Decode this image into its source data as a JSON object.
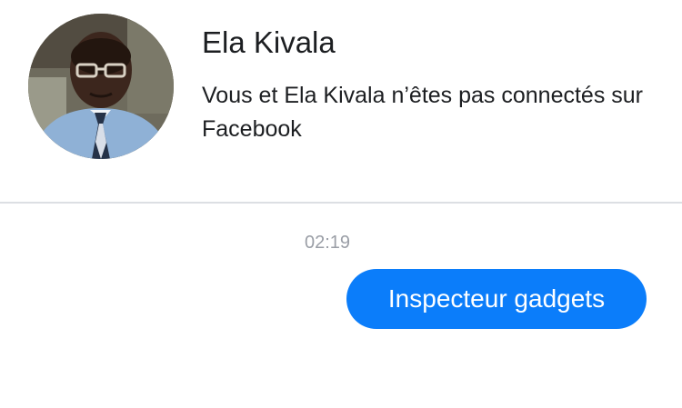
{
  "contact": {
    "name": "Ela Kivala",
    "connection_note": "Vous et Ela Kivala n’êtes pas connectés sur Facebook",
    "avatar_icon": "profile-photo"
  },
  "conversation": {
    "timestamp": "02:19",
    "messages": [
      {
        "direction": "outgoing",
        "text": "Inspecteur gadgets",
        "color": "#0B7DFA"
      }
    ]
  },
  "colors": {
    "background": "#FFFFFF",
    "divider": "#DCDFE3",
    "timestamp": "#9A9EA6",
    "outgoing_bubble": "#0B7DFA",
    "outgoing_text": "#FFFFFF"
  }
}
